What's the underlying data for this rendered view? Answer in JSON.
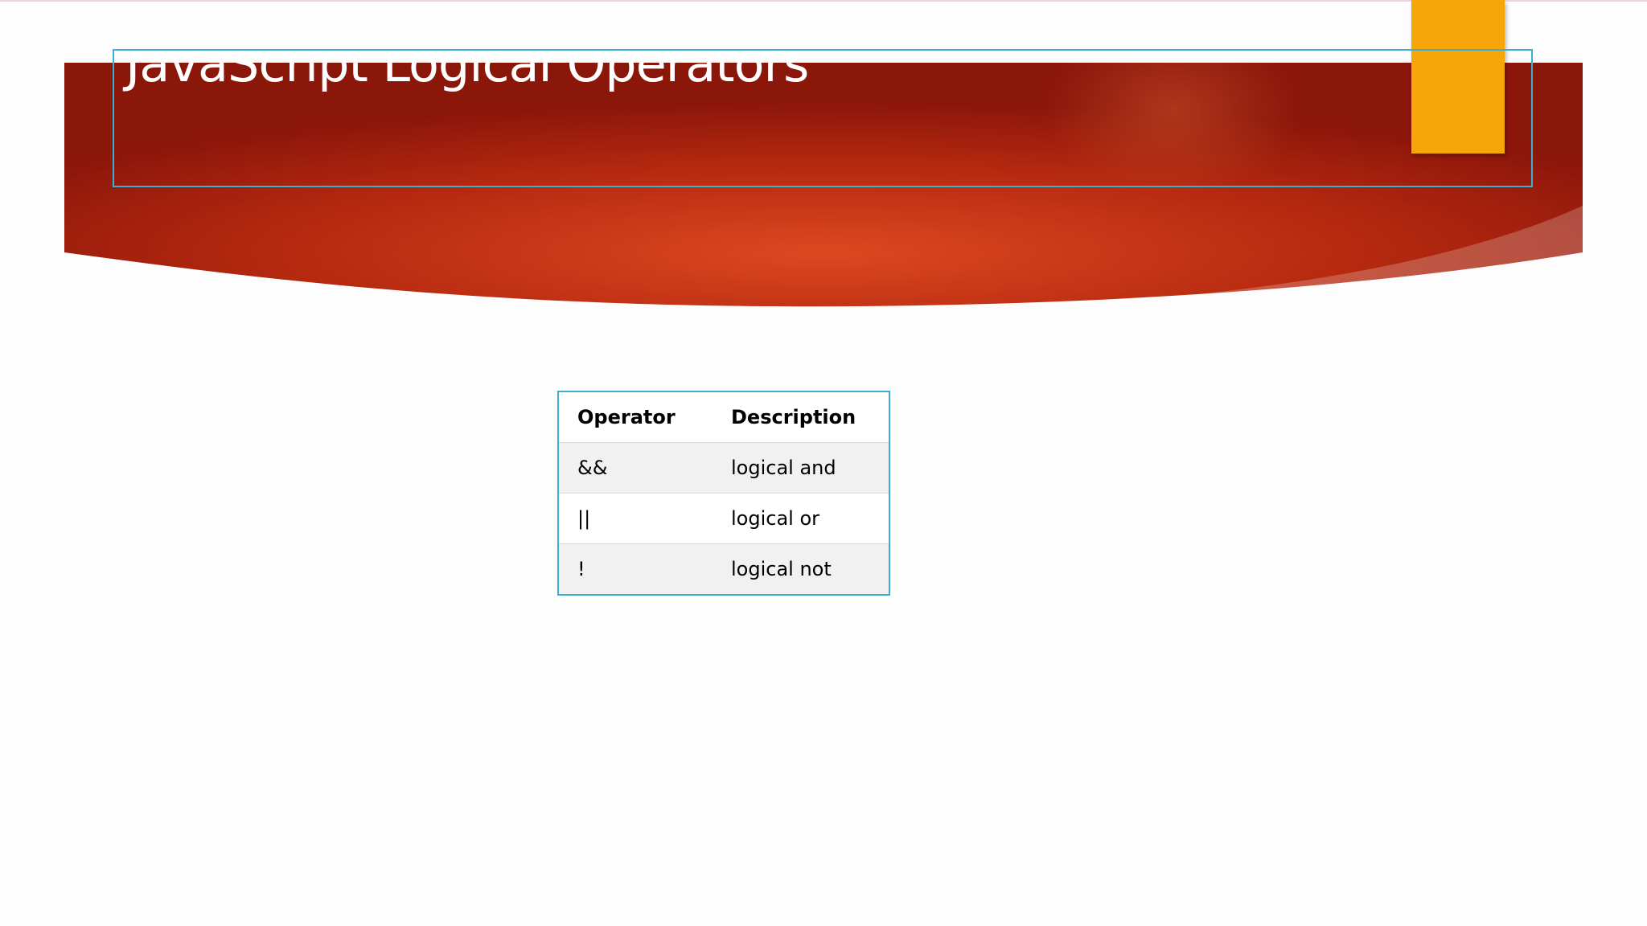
{
  "slide": {
    "title": "JavaScript Logical Operators"
  },
  "colors": {
    "banner_dark": "#8b160a",
    "banner_mid": "#b82a10",
    "banner_light": "#dc4820",
    "accent_tab": "#f6a50b",
    "placeholder_border": "#3aafcf"
  },
  "table": {
    "headers": [
      "Operator",
      "Description"
    ],
    "rows": [
      [
        "&&",
        "logical and"
      ],
      [
        "||",
        "logical or"
      ],
      [
        "!",
        "logical not"
      ]
    ]
  }
}
